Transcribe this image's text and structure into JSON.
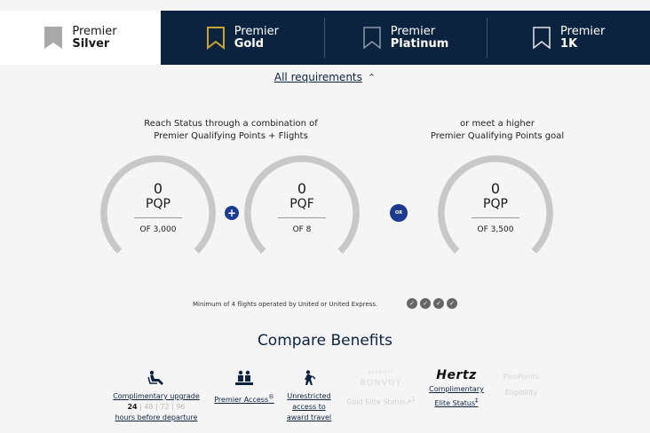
{
  "tabs": [
    {
      "line1": "Premier",
      "line2": "Silver",
      "active": true
    },
    {
      "line1": "Premier",
      "line2": "Gold",
      "active": false
    },
    {
      "line1": "Premier",
      "line2": "Platinum",
      "active": false
    },
    {
      "line1": "Premier",
      "line2": "1K",
      "active": false
    }
  ],
  "requirements": {
    "link": "All requirements",
    "caret": "^"
  },
  "captions": {
    "left_line1": "Reach Status through a combination of",
    "left_line2": "Premier Qualifying Points + Flights",
    "right_line1": "or meet a higher",
    "right_line2": "Premier Qualifying Points goal"
  },
  "gauges": [
    {
      "value": "0",
      "unit": "PQP",
      "of": "OF 3,000"
    },
    {
      "value": "0",
      "unit": "PQF",
      "of": "OF 8"
    },
    {
      "value": "0",
      "unit": "PQP",
      "of": "OF 3,500"
    }
  ],
  "badges": {
    "plus": "+",
    "or": "OR"
  },
  "min_flights": "Minimum of 4 flights operated by United or United Express.",
  "compare_title": "Compare Benefits",
  "benefits": {
    "upgrade": {
      "label": "Complimentary upgrade",
      "hours_active": "24",
      "hours_rest": [
        " | 48 | 72 | 96"
      ],
      "sub": "hours before departure"
    },
    "premier_access": {
      "label": "Premier Access",
      "mark": "®"
    },
    "award_travel": {
      "line1": "Unrestricted",
      "line2": "access to",
      "line3": "award travel"
    },
    "bonvoy": {
      "brand_small": "MARRIOTT",
      "brand": "BONVOY",
      "label": "Gold Elite Status",
      "sup": "1"
    },
    "hertz": {
      "brand": "Hertz",
      "line1": "Complimentary",
      "line2": "Elite Status",
      "sup": "‡"
    },
    "pluspoints": {
      "brand": "PlusPoints",
      "label": "Eligibility"
    }
  },
  "colors": {
    "navy": "#0c2340",
    "badge_blue": "#1a3b8f",
    "gold": "#c9a234",
    "gauge_grey": "#c8c8c8"
  }
}
